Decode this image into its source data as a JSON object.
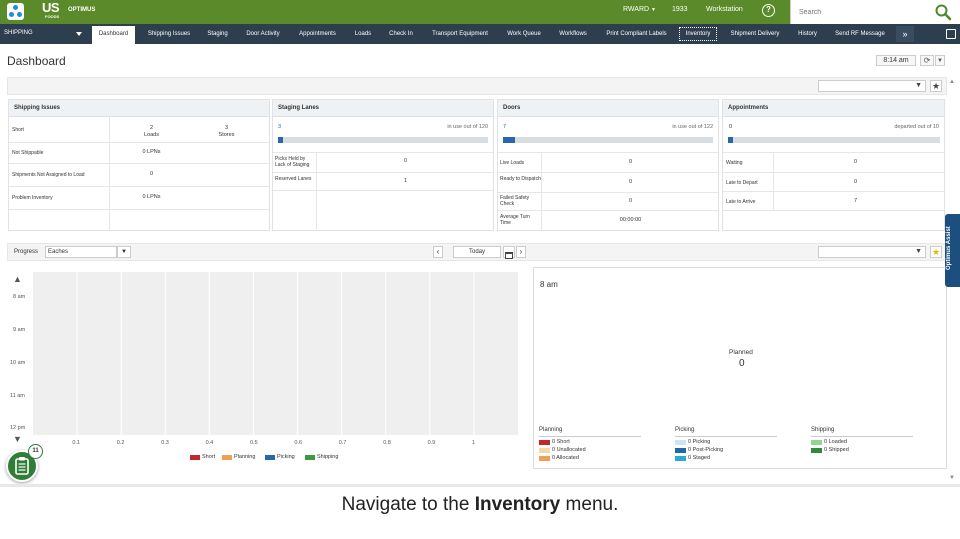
{
  "header": {
    "logo_us": "US",
    "logo_foods": "FOODS",
    "logo_product": "OPTIMUS",
    "user": "RWARD",
    "site": "1933",
    "workstation": "Workstation",
    "help_glyph": "?"
  },
  "search": {
    "placeholder": "Search"
  },
  "nav": {
    "section": "SHIPPING",
    "tabs": [
      "Dashboard",
      "Shipping Issues",
      "Staging",
      "Door Activity",
      "Appointments",
      "Loads",
      "Check In",
      "Transport Equipment",
      "Work Queue",
      "Workflows",
      "Print Compliant Labels",
      "Inventory",
      "Shipment Delivery",
      "History",
      "Send RF Message"
    ],
    "active_tab": "Dashboard",
    "focused_tab": "Inventory",
    "more_glyph": "»"
  },
  "page": {
    "title": "Dashboard",
    "time": "8:14 am"
  },
  "shipping_issues": {
    "title": "Shipping Issues",
    "rows": [
      {
        "label": "Short",
        "col1_value": "2",
        "col1_unit": "Loads",
        "col2_value": "3",
        "col2_unit": "Stores"
      },
      {
        "label": "Not Shippable",
        "value": "0  LPNs"
      },
      {
        "label": "Shipments Not Assigned to Load",
        "value": "0"
      },
      {
        "label": "Problem Inventory",
        "value": "0  LPNs"
      }
    ]
  },
  "staging_lanes": {
    "title": "Staging Lanes",
    "in_use": "3",
    "in_use_text": "in use out of 120",
    "in_use_fraction": 0.025,
    "rows": [
      {
        "label": "Picks Held by Lack of Staging",
        "value": "0"
      },
      {
        "label": "Reserved Lanes",
        "value": "1"
      }
    ]
  },
  "doors": {
    "title": "Doors",
    "in_use": "7",
    "in_use_text": "in use out of 122",
    "in_use_fraction": 0.057,
    "rows": [
      {
        "label": "Live Loads",
        "value": "0"
      },
      {
        "label": "Ready to Dispatch",
        "value": "0"
      },
      {
        "label": "Failed Safety Check",
        "value": "0"
      },
      {
        "label": "Average Turn Time",
        "value": "00:00:00"
      }
    ]
  },
  "appointments": {
    "title": "Appointments",
    "departed": "0",
    "departed_text": "departed out of 10",
    "departed_fraction": 0,
    "rows": [
      {
        "label": "Waiting",
        "value": "0"
      },
      {
        "label": "Late to Depart",
        "value": "0"
      },
      {
        "label": "Late to Arrive",
        "value": "7"
      }
    ]
  },
  "progress": {
    "label": "Progress",
    "unit_select": "Eaches",
    "date": "Today"
  },
  "chart_data": {
    "type": "bar",
    "orientation": "horizontal",
    "categories": [
      "8 am",
      "9 am",
      "10 am",
      "11 am",
      "12 pm"
    ],
    "x_ticks": [
      "0.1",
      "0.2",
      "0.3",
      "0.4",
      "0.5",
      "0.6",
      "0.7",
      "0.8",
      "0.9",
      "1"
    ],
    "xlim": [
      0,
      1
    ],
    "grid": true,
    "legend_position": "bottom",
    "series": [
      {
        "name": "Short",
        "color": "#c0282d",
        "values": [
          0,
          0,
          0,
          0,
          0
        ]
      },
      {
        "name": "Planning",
        "color": "#f0a050",
        "values": [
          0,
          0,
          0,
          0,
          0
        ]
      },
      {
        "name": "Picking",
        "color": "#2a66b0",
        "values": [
          0,
          0,
          0,
          0,
          0
        ]
      },
      {
        "name": "Shipping",
        "color": "#3a9a48",
        "values": [
          0,
          0,
          0,
          0,
          0
        ]
      }
    ]
  },
  "summary": {
    "time": "8 am",
    "planned_label": "Planned",
    "planned_value": "0",
    "groups": [
      {
        "title": "Planning",
        "items": [
          {
            "text": "0  Short",
            "color": "#c0282d"
          },
          {
            "text": "0  Unallocated",
            "color": "#f6d8a8"
          },
          {
            "text": "0  Allocated",
            "color": "#f0a050"
          }
        ]
      },
      {
        "title": "Picking",
        "items": [
          {
            "text": "0  Picking",
            "color": "#c9e6f2"
          },
          {
            "text": "0  Post-Picking",
            "color": "#1e6aa8"
          },
          {
            "text": "0  Staged",
            "color": "#2aa8d8"
          }
        ]
      },
      {
        "title": "Shipping",
        "items": [
          {
            "text": "0  Loaded",
            "color": "#8ed88e"
          },
          {
            "text": "0  Shipped",
            "color": "#2f8a3a"
          }
        ]
      }
    ]
  },
  "assist": {
    "label": "Optimus Assist",
    "badge": "11"
  },
  "caption": {
    "prefix": "Navigate to the ",
    "bold": "Inventory",
    "suffix": " menu."
  },
  "colors": {
    "header_green": "#5a8a2a",
    "nav_dark": "#2d3e4f",
    "accent_blue": "#2a66b0",
    "assist_blue": "#1c4e7e"
  }
}
